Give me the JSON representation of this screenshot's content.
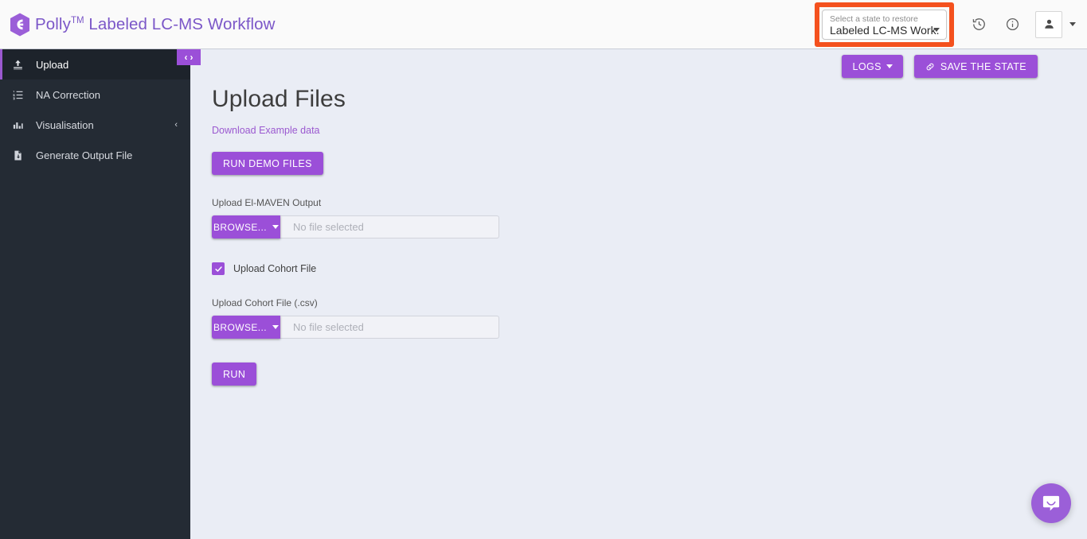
{
  "header": {
    "brand_name": "Polly",
    "brand_tm": "TM",
    "brand_product": "Labeled LC-MS Workflow",
    "logo_icon": "polly-hexagon-logo",
    "state_select": {
      "label": "Select a state to restore",
      "value": "Labeled LC-MS Work...",
      "caret_icon": "chevron-down-icon"
    },
    "history_icon": "history-clock-icon",
    "info_icon": "info-circle-icon",
    "avatar_icon": "person-icon",
    "avatar_caret_icon": "chevron-down-icon",
    "highlight_color": "#f4511e"
  },
  "sidebar": {
    "toggle": {
      "prev_icon": "chevron-left-icon",
      "next_icon": "chevron-right-icon",
      "prev_glyph": "‹",
      "next_glyph": "›"
    },
    "items": [
      {
        "label": "Upload",
        "icon": "upload-icon",
        "active": true,
        "has_caret": false
      },
      {
        "label": "NA Correction",
        "icon": "list-ordered-icon",
        "active": false,
        "has_caret": false
      },
      {
        "label": "Visualisation",
        "icon": "bar-chart-icon",
        "active": false,
        "has_caret": true,
        "caret_glyph": "‹"
      },
      {
        "label": "Generate Output File",
        "icon": "file-download-icon",
        "active": false,
        "has_caret": false
      }
    ]
  },
  "actions": {
    "logs_label": "LOGS",
    "logs_caret_icon": "chevron-down-icon",
    "save_state_label": "SAVE THE STATE",
    "save_state_icon": "link-icon"
  },
  "main": {
    "title": "Upload Files",
    "download_example_link": "Download Example data",
    "run_demo_label": "RUN DEMO FILES",
    "elmaven": {
      "label": "Upload El-MAVEN Output",
      "browse_label": "BROWSE...",
      "file_name": "No file selected"
    },
    "cohort_checkbox": {
      "label": "Upload Cohort File",
      "checked": true,
      "check_glyph": "✓"
    },
    "cohort": {
      "label": "Upload Cohort File (.csv)",
      "browse_label": "BROWSE...",
      "file_name": "No file selected"
    },
    "run_label": "RUN"
  },
  "chat": {
    "icon": "intercom-chat-bubble-icon"
  },
  "colors": {
    "accent_purple": "#9b4fd8",
    "brand_purple": "#7b57c8",
    "sidebar_bg": "#242b34",
    "page_bg": "#eaedf5",
    "highlight_orange": "#f4511e"
  }
}
